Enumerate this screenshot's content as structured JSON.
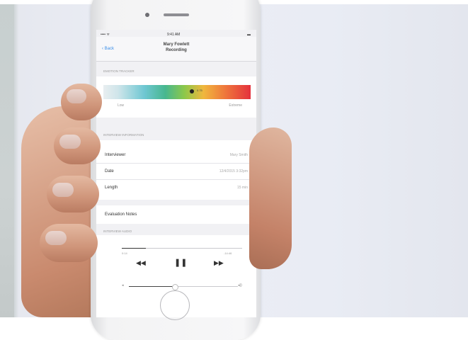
{
  "screen": {
    "status": {
      "left": "•••• ᯤ",
      "time": "9:41 AM",
      "right": "▬"
    },
    "nav": {
      "back_label": "‹ Back",
      "title_line1": "Mary Fowlett",
      "title_line2": "Recording"
    },
    "emotion_section": {
      "header": "EMOTION TRACKER",
      "marker_value": "0.75",
      "low_label": "Low",
      "high_label": "Extreme",
      "marker_level": 0.6
    },
    "info_section": {
      "header": "INTERVIEW INFORMATION",
      "rows": [
        {
          "key": "Interviewer",
          "value": "Mary Smith"
        },
        {
          "key": "Date",
          "value": "12/4/2015 3:32pm"
        },
        {
          "key": "Length",
          "value": "15 min"
        }
      ]
    },
    "notes_label": "Evaluation Notes",
    "audio_section": {
      "header": "INTERVIEW AUDIO",
      "elapsed": "0:14",
      "remaining": "-14:46",
      "progress": 0.2,
      "volume": 0.42,
      "rewind_label": "◀◀",
      "pause_label": "❚❚",
      "forward_label": "▶▶",
      "vol_low_icon": "◂",
      "vol_high_icon": "◂))"
    }
  },
  "colors": {
    "link": "#3b8ee8",
    "spectrum_low": "#6ec7d2",
    "spectrum_high": "#e4313c"
  }
}
